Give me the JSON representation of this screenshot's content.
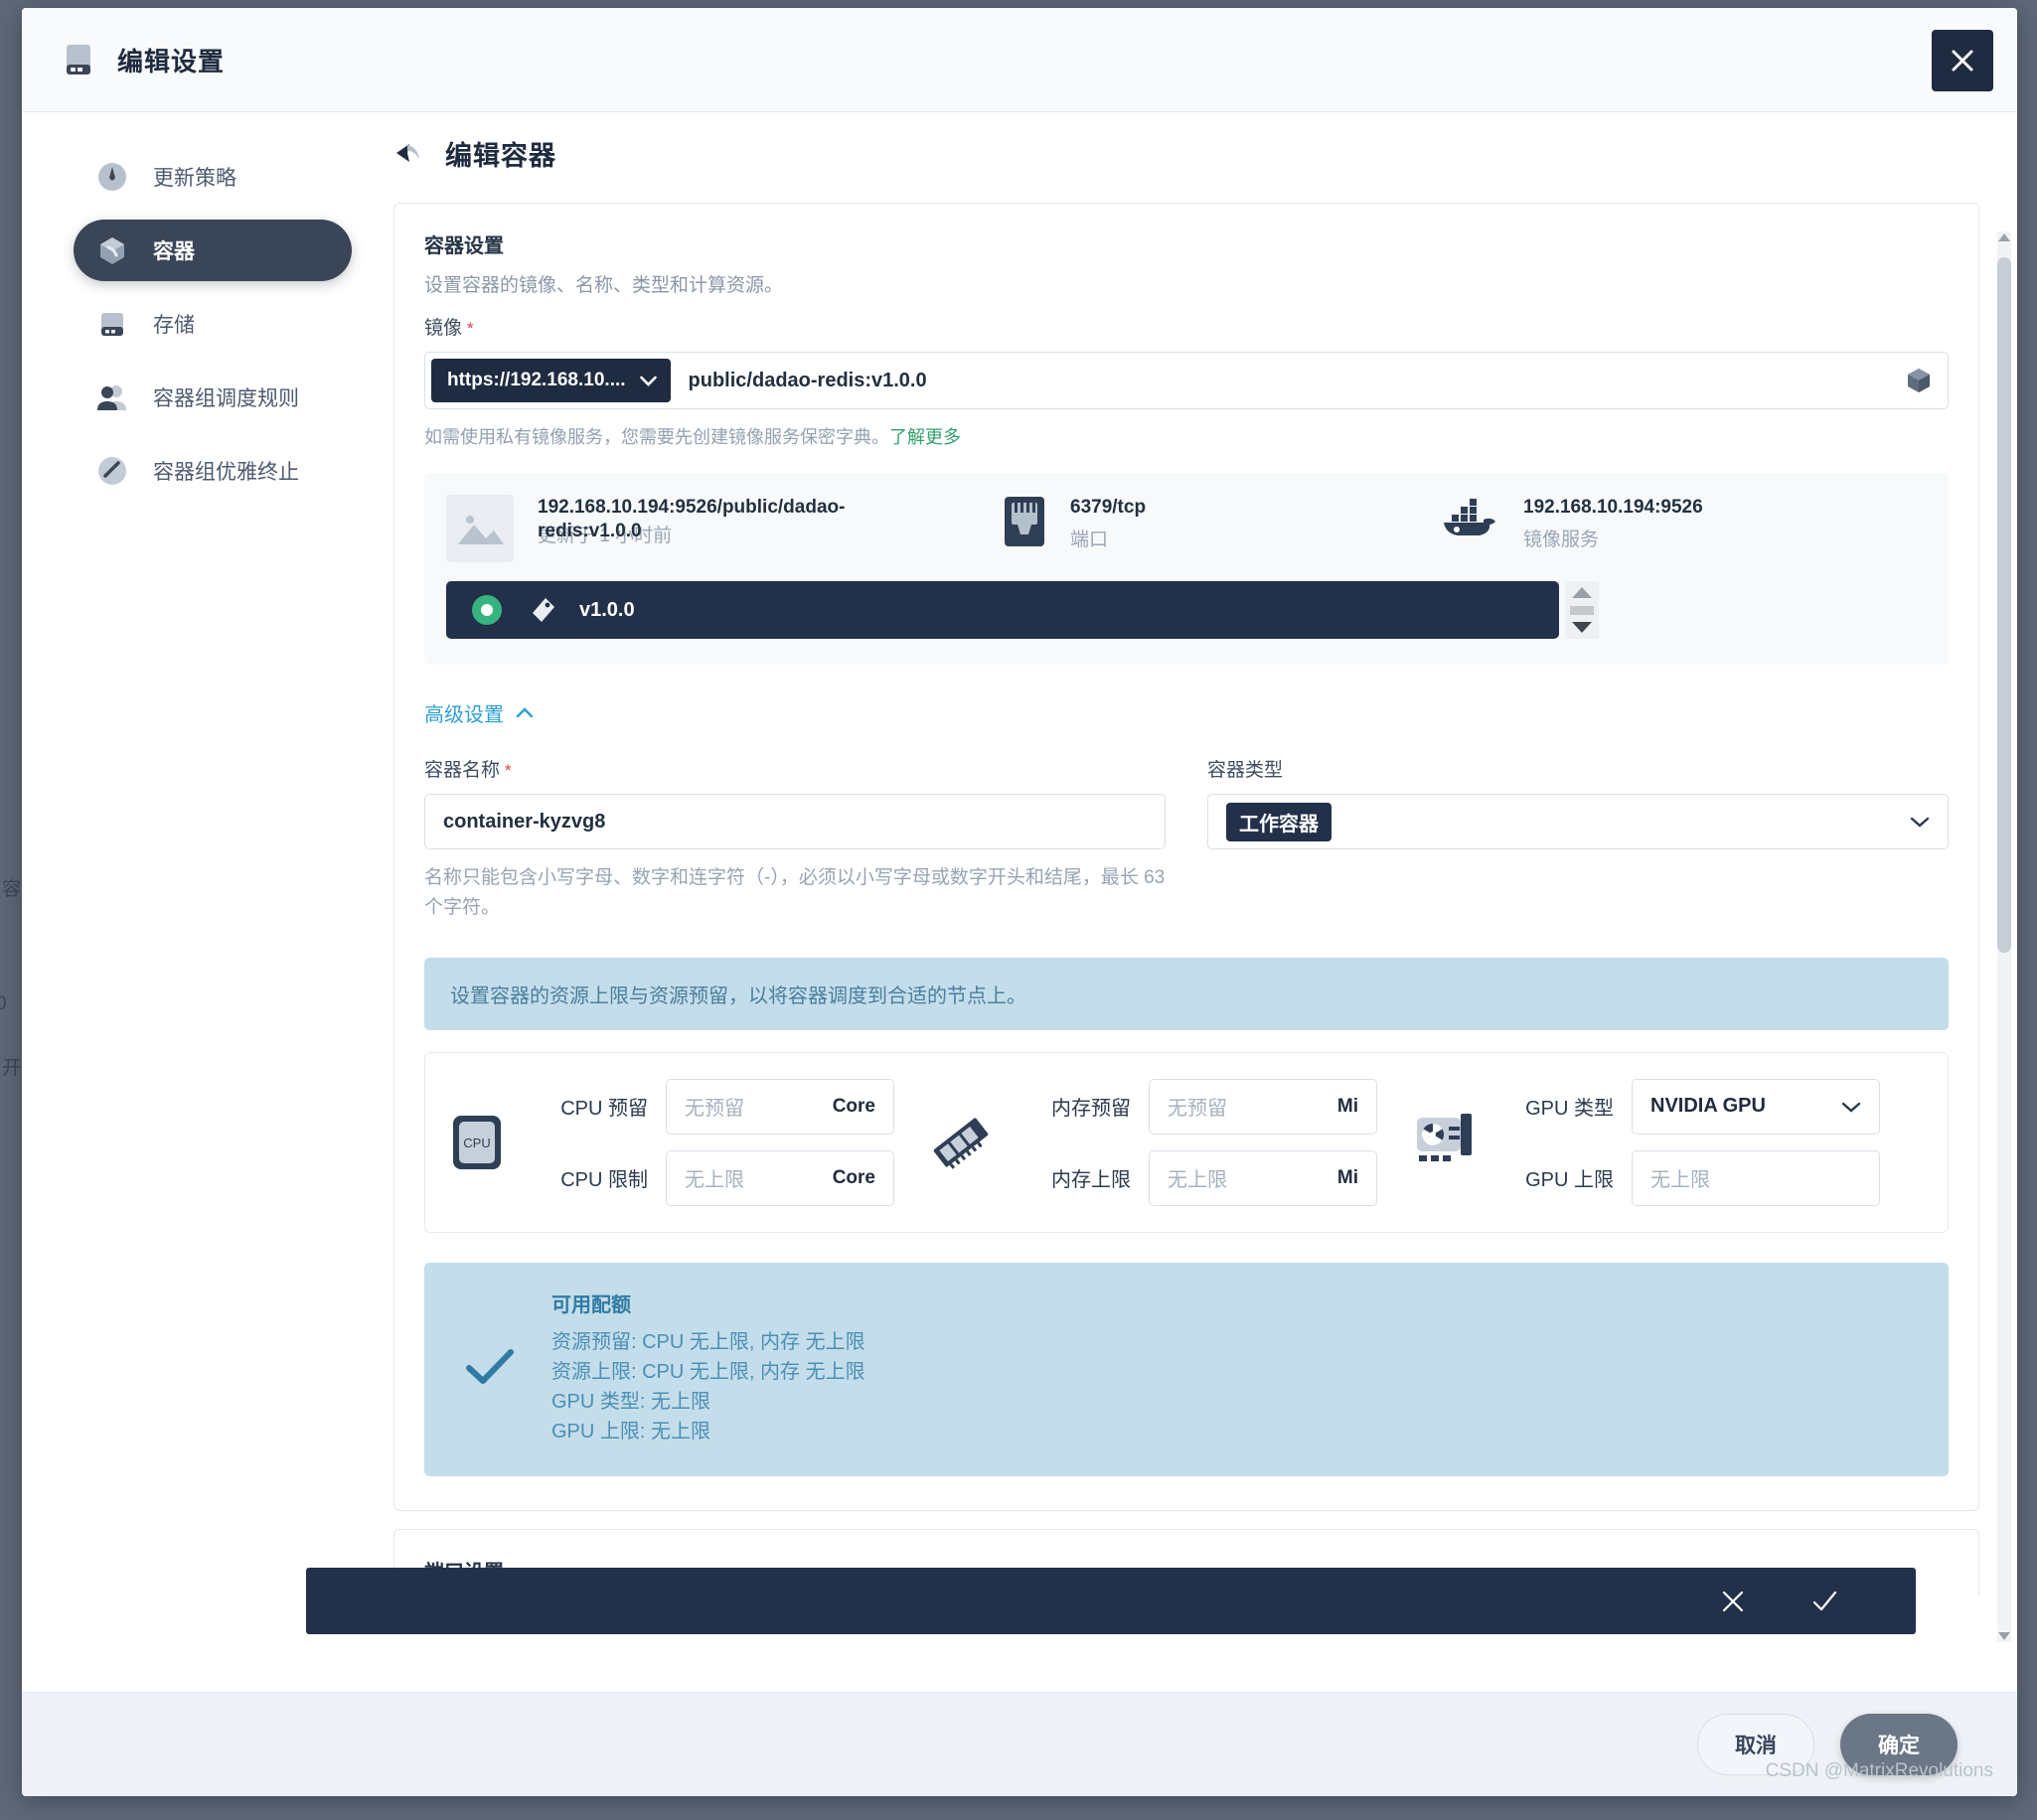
{
  "window": {
    "title": "编辑设置",
    "icon": "storage-icon",
    "close_icon": "close-icon"
  },
  "sidebar": {
    "items": [
      {
        "label": "更新策略",
        "icon": "clock-icon",
        "active": false
      },
      {
        "label": "容器",
        "icon": "container-icon",
        "active": true
      },
      {
        "label": "存储",
        "icon": "storage-icon",
        "active": false
      },
      {
        "label": "容器组调度规则",
        "icon": "people-icon",
        "active": false
      },
      {
        "label": "容器组优雅终止",
        "icon": "wand-icon",
        "active": false
      }
    ]
  },
  "main": {
    "back_icon": "back-arrow-icon",
    "page_title": "编辑容器",
    "container_settings": {
      "title": "容器设置",
      "description": "设置容器的镜像、名称、类型和计算资源。",
      "image_label": "镜像",
      "image_required": "*",
      "registry_chip": "https://192.168.10....",
      "image_path": "public/dadao-redis:v1.0.0",
      "cube_icon": "cube-icon",
      "hint_text": "如需使用私有镜像服务，您需要先创建镜像服务保密字典。",
      "hint_link": "了解更多",
      "info": {
        "image": {
          "icon": "image-placeholder-icon",
          "line1": "192.168.10.194:9526/public/dadao-",
          "line2_overlap_a": "redis:v1.0.0",
          "line2_overlap_b": "更新于 1 小时前"
        },
        "port": {
          "icon": "ethernet-port-icon",
          "value": "6379/tcp",
          "label": "端口"
        },
        "registry": {
          "icon": "docker-icon",
          "value": "192.168.10.194:9526",
          "label": "镜像服务"
        }
      },
      "tag_row": {
        "radio_icon": "radio-selected-icon",
        "tag_icon": "tag-icon",
        "tag_label": "v1.0.0"
      }
    },
    "advanced": {
      "toggle_label": "高级设置",
      "toggle_icon": "chevron-up-icon",
      "name_label": "容器名称",
      "name_required": "*",
      "name_value": "container-kyzvg8",
      "name_helper": "名称只能包含小写字母、数字和连字符（-），必须以小写字母或数字开头和结尾，最长 63 个字符。",
      "type_label": "容器类型",
      "type_value": "工作容器",
      "type_caret_icon": "chevron-down-icon"
    },
    "notice": "设置容器的资源上限与资源预留，以将容器调度到合适的节点上。",
    "resources": {
      "cpu": {
        "icon": "cpu-icon",
        "reserve_label": "CPU 预留",
        "reserve_placeholder": "无预留",
        "reserve_unit": "Core",
        "limit_label": "CPU 限制",
        "limit_placeholder": "无上限",
        "limit_unit": "Core"
      },
      "memory": {
        "icon": "memory-ram-icon",
        "reserve_label": "内存预留",
        "reserve_placeholder": "无预留",
        "reserve_unit": "Mi",
        "limit_label": "内存上限",
        "limit_placeholder": "无上限",
        "limit_unit": "Mi"
      },
      "gpu": {
        "icon": "gpu-card-icon",
        "type_label": "GPU 类型",
        "type_value": "NVIDIA GPU",
        "type_caret_icon": "chevron-down-icon",
        "limit_label": "GPU 上限",
        "limit_placeholder": "无上限"
      }
    },
    "quota": {
      "check_icon": "check-icon",
      "title": "可用配额",
      "lines": [
        "资源预留: CPU 无上限, 内存 无上限",
        "资源上限: CPU 无上限, 内存 无上限",
        "GPU 类型: 无上限",
        "GPU 上限: 无上限"
      ]
    },
    "port_section_title": "端口设置",
    "action_bar": {
      "cancel_icon": "x-icon",
      "confirm_icon": "check-icon"
    }
  },
  "footer": {
    "cancel_label": "取消",
    "confirm_label": "确定"
  },
  "watermark": "CSDN @MatrixRevolutions",
  "colors": {
    "accent_dark": "#22304a",
    "accent_blue": "#2e9fd4",
    "green": "#36b37e",
    "notice_bg": "#c4ddea",
    "required_red": "#d94343"
  }
}
